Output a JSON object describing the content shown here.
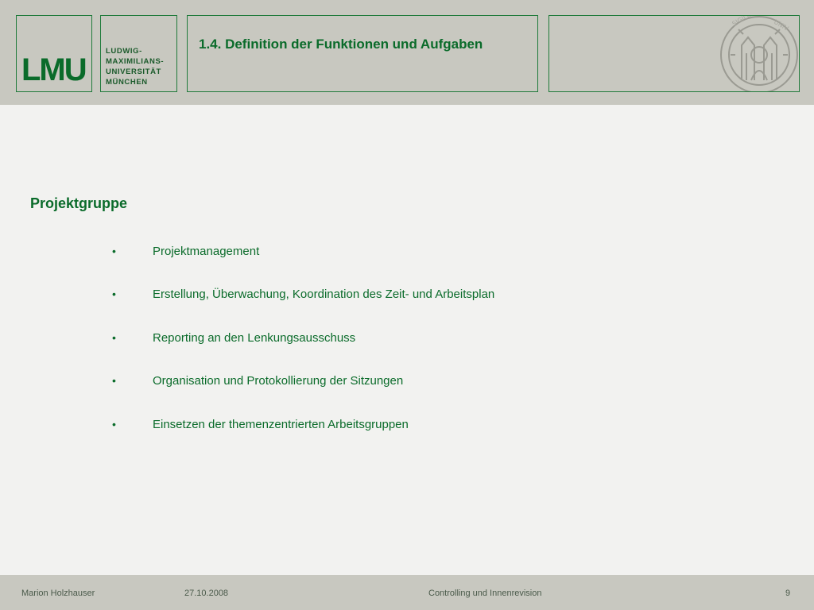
{
  "header": {
    "logo_text": "LMU",
    "university_lines": [
      "LUDWIG-",
      "MAXIMILIANS-",
      "UNIVERSITÄT",
      "MÜNCHEN"
    ],
    "title": "1.4. Definition der Funktionen und Aufgaben",
    "seal_icon": "university-seal-icon"
  },
  "main": {
    "heading": "Projektgruppe",
    "bullets": [
      "Projektmanagement",
      "Erstellung, Überwachung, Koordination des Zeit- und Arbeitsplan",
      "Reporting an den Lenkungsausschuss",
      "Organisation und Protokollierung der Sitzungen",
      "Einsetzen der themenzentrierten Arbeitsgruppen"
    ]
  },
  "footer": {
    "author": "Marion Holzhauser",
    "date": "27.10.2008",
    "course": "Controlling und Innenrevision",
    "page": "9"
  },
  "colors": {
    "accent": "#0a6b2a",
    "band": "#c8c8c0",
    "background": "#f2f2f0"
  }
}
